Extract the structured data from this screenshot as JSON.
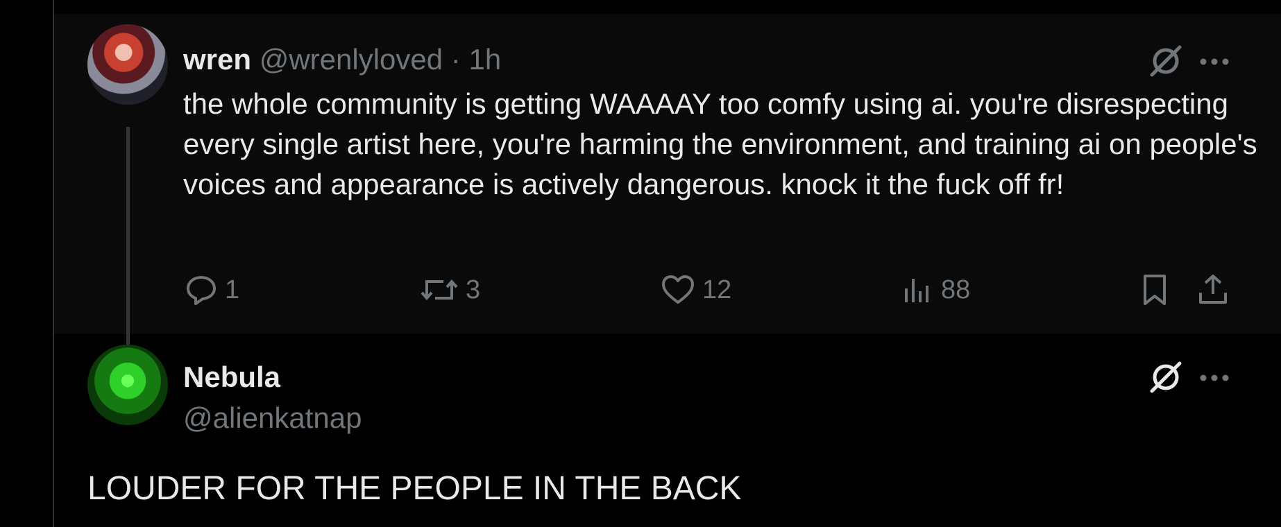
{
  "parent_post": {
    "display_name": "wren",
    "handle": "@wrenlyloved",
    "separator": "·",
    "time": "1h",
    "text": "the whole community is getting WAAAAY too comfy using ai. you're disrespecting every single artist here, you're harming the environment, and training ai on people's voices and appearance is actively dangerous. knock it the fuck off fr!",
    "actions": {
      "replies": "1",
      "reposts": "3",
      "likes": "12",
      "views": "88"
    }
  },
  "reply_post": {
    "display_name": "Nebula",
    "handle": "@alienkatnap",
    "text": "LOUDER FOR THE PEOPLE IN THE BACK"
  },
  "colors": {
    "background": "#000000",
    "parent_background": "#0a0a0a",
    "text": "#e7e9ea",
    "muted": "#71767b",
    "divider": "#2f3336"
  },
  "icons": {
    "grok": "grok-icon",
    "more": "more-icon",
    "reply": "reply-icon",
    "repost": "repost-icon",
    "like": "like-icon",
    "views": "views-icon",
    "bookmark": "bookmark-icon",
    "share": "share-icon"
  }
}
